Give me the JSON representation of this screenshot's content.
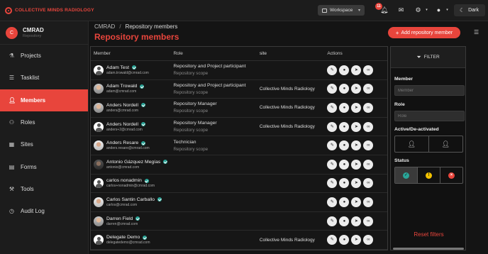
{
  "topbar": {
    "brand": "COLLECTIVE MINDS RADIOLOGY",
    "workspace_label": "Workspace",
    "notification_count": "11",
    "theme_label": "Dark"
  },
  "sidebar": {
    "org_initial": "C",
    "org_name": "CMRAD",
    "org_sub": "Repository",
    "items": [
      {
        "label": "Projects",
        "icon": "flask-icon"
      },
      {
        "label": "Tasklist",
        "icon": "list-icon"
      },
      {
        "label": "Members",
        "icon": "users-icon"
      },
      {
        "label": "Roles",
        "icon": "roles-icon"
      },
      {
        "label": "Sites",
        "icon": "sites-icon"
      },
      {
        "label": "Forms",
        "icon": "forms-icon"
      },
      {
        "label": "Tools",
        "icon": "tools-icon"
      },
      {
        "label": "Audit Log",
        "icon": "audit-log-icon"
      }
    ]
  },
  "header": {
    "crumb_root": "CMRAD",
    "crumb_sep": "/",
    "crumb_current": "Repository members",
    "title": "Repository members",
    "add_label": "Add repository member"
  },
  "table": {
    "columns": {
      "member": "Member",
      "role": "Role",
      "site": "site",
      "actions": "Actions"
    },
    "rows": [
      {
        "name": "Adam Test",
        "email": "adam.trowald@cmrad.com",
        "avatar": "default",
        "role": "Repository and Project participant",
        "scope": "Repository scope",
        "site": ""
      },
      {
        "name": "Adam Trowald",
        "email": "adam@cmrad.com",
        "avatar": "photo",
        "role": "Repository and Project participant",
        "scope": "Repository scope",
        "site": "Collective Minds Radiology"
      },
      {
        "name": "Anders Nordell",
        "email": "anders@cmrad.com",
        "avatar": "photo",
        "role": "Repository Manager",
        "scope": "Repository scope",
        "site": "Collective Minds Radiology"
      },
      {
        "name": "Anders Nordell",
        "email": "anders+2@cmrad.com",
        "avatar": "default",
        "role": "Repository Manager",
        "scope": "Repository scope",
        "site": "Collective Minds Radiology"
      },
      {
        "name": "Anders Resare",
        "email": "anders.resare@cmrad.com",
        "avatar": "photo2",
        "role": "Technician",
        "scope": "Repository scope",
        "site": ""
      },
      {
        "name": "Antonio Gázquez Megías",
        "email": "antonio@cmrad.com",
        "avatar": "photo3",
        "role": "",
        "scope": "",
        "site": ""
      },
      {
        "name": "carlos nonadmin",
        "email": "carlos+nonadmin@cmrad.com",
        "avatar": "default",
        "role": "",
        "scope": "",
        "site": ""
      },
      {
        "name": "Carlos Santin Carballo",
        "email": "carlos@cmrad.com",
        "avatar": "photo2",
        "role": "",
        "scope": "",
        "site": ""
      },
      {
        "name": "Darren Field",
        "email": "darren@cmrad.com",
        "avatar": "photo",
        "role": "",
        "scope": "",
        "site": ""
      },
      {
        "name": "Delegate Demo",
        "email": "delegatedemo@cmrad.com",
        "avatar": "default",
        "role": "",
        "scope": "",
        "site": "Collective Minds Radiology"
      }
    ],
    "action_icons": [
      "edit-icon",
      "user-icon",
      "send-icon",
      "link-icon"
    ]
  },
  "filter": {
    "title": "FILTER",
    "member_label": "Member",
    "member_placeholder": "Member",
    "role_label": "Role",
    "role_placeholder": "Role",
    "active_label": "Active/De-activated",
    "status_label": "Status",
    "reset_label": "Reset filters"
  },
  "colors": {
    "accent": "#e8453c",
    "verified": "#2aa598",
    "status_ok": "#2aa598",
    "status_warn": "#f2c200",
    "status_err": "#e8453c"
  }
}
